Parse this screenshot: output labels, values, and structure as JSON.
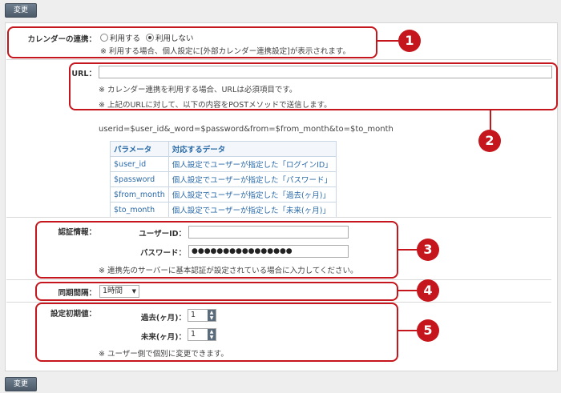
{
  "buttons": {
    "change_top": "変更",
    "change_bottom": "変更"
  },
  "calendar": {
    "label": "カレンダーの連携：",
    "option_use": "利用する",
    "option_nouse": "利用しない",
    "selected": "利用しない",
    "note": "※ 利用する場合、個人設定に[外部カレンダー連携設定]が表示されます。"
  },
  "url": {
    "label": "URL：",
    "value": "",
    "note1": "※ カレンダー連携を利用する場合、URLは必須項目です。",
    "note2": "※ 上記のURLに対して、以下の内容をPOSTメソッドで送信します。",
    "query": "userid=$user_id&_word=$password&from=$from_month&to=$to_month"
  },
  "param_table": {
    "headers": [
      "パラメータ",
      "対応するデータ"
    ],
    "rows": [
      [
        "$user_id",
        "個人設定でユーザーが指定した「ログインID」"
      ],
      [
        "$password",
        "個人設定でユーザーが指定した「パスワード」"
      ],
      [
        "$from_month",
        "個人設定でユーザーが指定した「過去(ヶ月)」"
      ],
      [
        "$to_month",
        "個人設定でユーザーが指定した「未来(ヶ月)」"
      ]
    ]
  },
  "auth": {
    "label": "認証情報：",
    "userid_label": "ユーザーID：",
    "userid_value": "",
    "password_label": "パスワード：",
    "password_value": "●●●●●●●●●●●●●●●●",
    "note": "※ 連携先のサーバーに基本認証が設定されている場合に入力してください。"
  },
  "sync": {
    "label": "同期間隔：",
    "value": "1時間"
  },
  "defaults": {
    "label": "設定初期値：",
    "past_label": "過去(ヶ月)：",
    "past_value": "1",
    "future_label": "未来(ヶ月)：",
    "future_value": "1",
    "note": "※ ユーザー側で個別に変更できます。"
  },
  "callouts": [
    "1",
    "2",
    "3",
    "4",
    "5"
  ],
  "colors": {
    "callout_red": "#c4161c",
    "link_blue": "#2a6aa8",
    "button_gray": "#5a6b7c"
  }
}
